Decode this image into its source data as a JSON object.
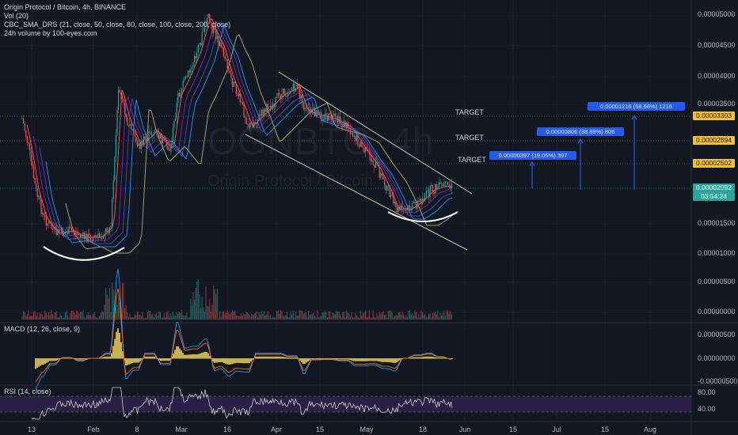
{
  "legend": {
    "title": "Origin Protocol / Bitcoin, 4h, BINANCE",
    "vol": "Vol (20)",
    "sma": "CBC_SMA_DRS (21, close, 50, close, 80, close, 100, close, 200, close)",
    "volume24h": "24h volume by 100-eyes.com"
  },
  "watermark": {
    "symbol": "OGNBTC, 4h",
    "name": "Origin Protocol / Bitcoin"
  },
  "price_axis": [
    "0.00005000",
    "0.00004500",
    "0.00004000",
    "0.00003500",
    "0.00001500",
    "0.00001000",
    "0.00000500",
    "0.00000000"
  ],
  "price_tags": {
    "t3": "0.00003303",
    "t2": "0.00002894",
    "t1": "0.00002502",
    "last": "0.00002092",
    "countdown": "03:54:24"
  },
  "targets": {
    "label": "TARGET"
  },
  "measures": [
    "0.00000397 (19.05%) 397",
    "0.00000806 (38.89%) 806",
    "0.00001216 (58.66%) 1216"
  ],
  "macd": {
    "title": "MACD (12, 26, close, 9)",
    "axis": [
      "0.00000500",
      "0.00000000",
      "-0.00000500"
    ]
  },
  "rsi": {
    "title": "RSI (14, close)",
    "axis": [
      "80.00",
      "40.00"
    ]
  },
  "time_axis": [
    "13",
    "Feb",
    "8",
    "Mar",
    "16",
    "Apr",
    "15",
    "May",
    "18",
    "Jun",
    "15",
    "Jul",
    "15",
    "Aug"
  ],
  "colors": {
    "background": "#131722",
    "candle_up": "#26a69a",
    "candle_down": "#ef5350",
    "target_tag": "#fbc02d",
    "last_tag": "#26a69a",
    "measure": "#2962ff",
    "rsi_band": "#2a1f45"
  }
}
